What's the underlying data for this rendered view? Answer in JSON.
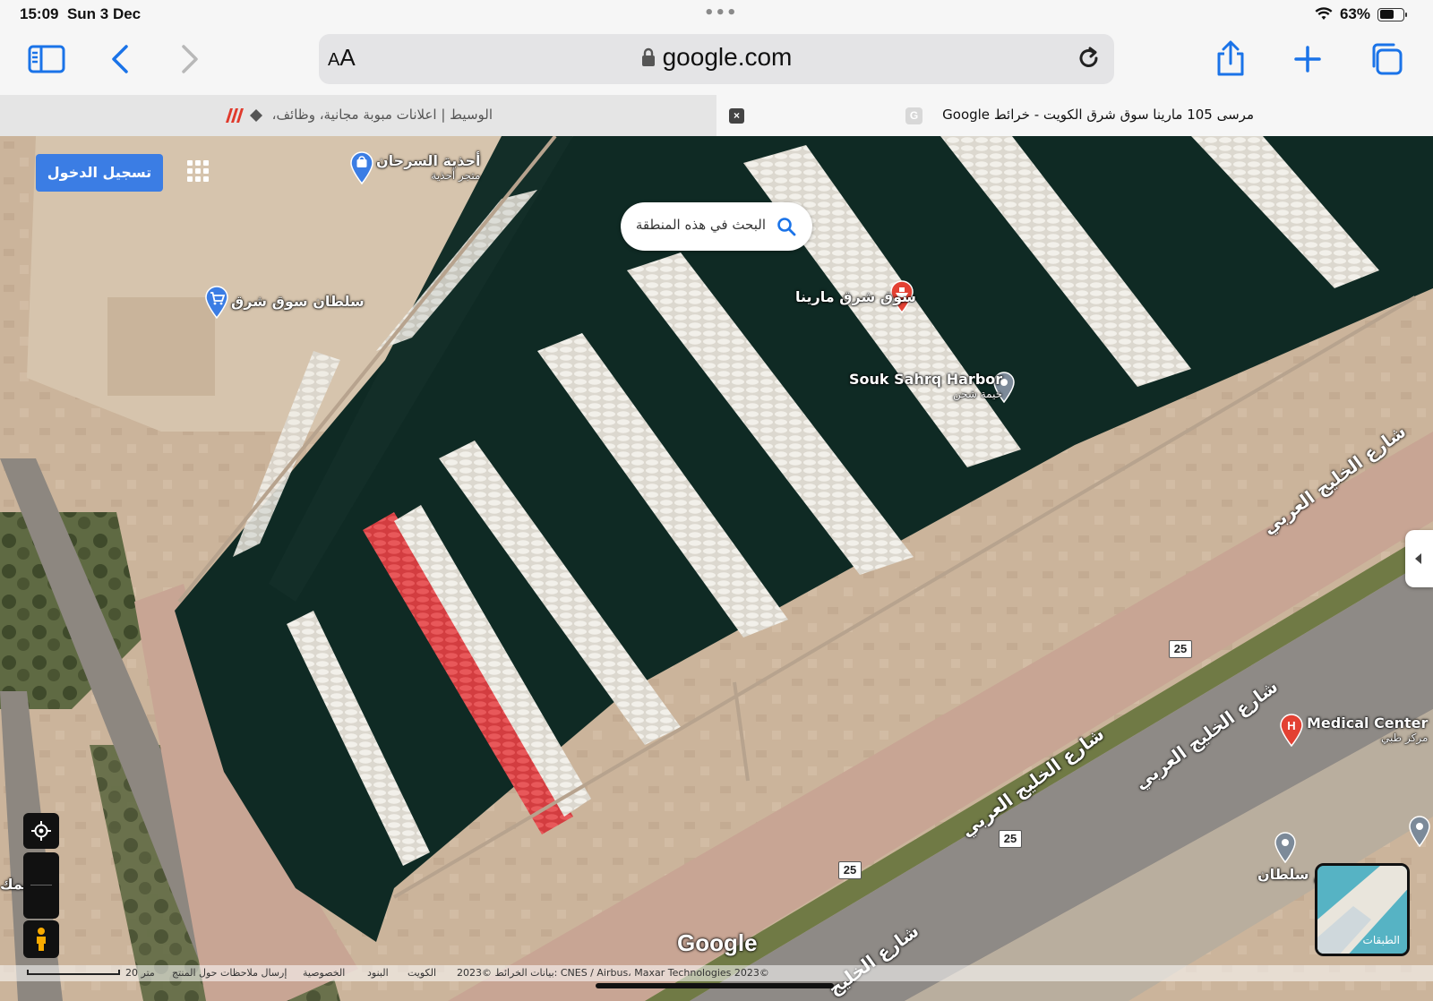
{
  "status": {
    "time": "15:09",
    "date": "Sun 3 Dec",
    "battery": "63%",
    "battery_level": 0.63
  },
  "toolbar": {
    "aa_small": "A",
    "aa_big": "A",
    "domain": "google.com"
  },
  "tabs": {
    "inactive_title": "الوسيط | اعلانات مبوبة مجانية، وظائف،",
    "active_title": "مرسى 105 مارينا سوق شرق الكويت - خرائط Google",
    "favicon_letter": "G",
    "close_symbol": "×"
  },
  "map": {
    "signin": "تسجيل الدخول",
    "search_area": "البحث في هذه المنطقة",
    "pois": {
      "sarhan": {
        "name": "أحذية السرحان",
        "sub": "متجر أحذية"
      },
      "sultan_market": {
        "name": "سلطان سوق شرق"
      },
      "marina": {
        "name": "سوق شرق مارينا"
      },
      "harbor": {
        "name": "Souk Sahrq Harbor",
        "sub": "خيمة شحن"
      },
      "medical": {
        "name": "Medical Center",
        "sub": "مركز طبي"
      },
      "sultan_bottom": {
        "name": "ثم سلطان"
      },
      "left_cut": {
        "name": "سمك"
      }
    },
    "roads": {
      "r1": "شارع الخليج العربي",
      "r2": "شارع الخليج العربي",
      "r3": "شارع الخليج العربي",
      "r4": "شارع الخليج"
    },
    "route": "25",
    "layers": "الطبقات",
    "google": "Google",
    "footer": {
      "copyright": "2023© بيانات الخرائط: CNES / Airbus، Maxar Technologies 2023©",
      "kuwait": "الكويت",
      "terms": "البنود",
      "privacy": "الخصوصية",
      "feedback": "إرسال ملاحظات حول المنتج",
      "scale": "20 متر"
    }
  },
  "colors": {
    "accent": "#3b7de4",
    "water": "#0f2a24",
    "quay": "#c8a594",
    "red_boats": "#e0494c"
  }
}
